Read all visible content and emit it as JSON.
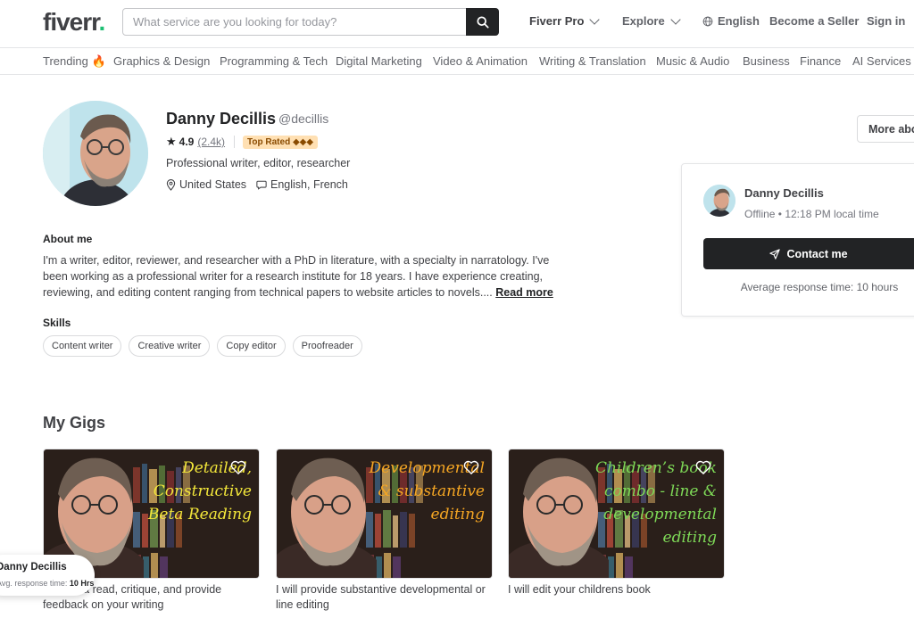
{
  "header": {
    "logo_text": "fiverr",
    "logo_dot": ".",
    "search_placeholder": "What service are you looking for today?",
    "nav": {
      "fiverr_pro": "Fiverr Pro",
      "explore": "Explore",
      "language": "English",
      "become_seller": "Become a Seller",
      "sign_in": "Sign in"
    }
  },
  "categories": [
    "Trending 🔥",
    "Graphics & Design",
    "Programming & Tech",
    "Digital Marketing",
    "Video & Animation",
    "Writing & Translation",
    "Music & Audio",
    "Business",
    "Finance",
    "AI Services"
  ],
  "profile": {
    "name": "Danny Decillis",
    "handle": "@decillis",
    "rating": "4.9",
    "review_count": "(2.4k)",
    "badge": "Top Rated ◆◆◆",
    "tagline": "Professional writer, editor, researcher",
    "location": "United States",
    "languages": "English, French",
    "more_about": "More about me"
  },
  "about": {
    "title": "About me",
    "text": "I'm a writer, editor, reviewer, and researcher with a PhD in literature, with a specialty in narratology. I've been working as a professional writer for a research institute for 18 years. I have experience creating, reviewing, and editing content ranging from technical papers to website articles to novels....",
    "read_more": "Read more"
  },
  "skills": {
    "title": "Skills",
    "items": [
      "Content writer",
      "Creative writer",
      "Copy editor",
      "Proofreader"
    ]
  },
  "contact_card": {
    "name": "Danny Decillis",
    "status": "Offline • 12:18 PM local time",
    "button": "Contact me",
    "response": "Average response time: 10 hours"
  },
  "gigs": {
    "title": "My Gigs",
    "items": [
      {
        "overlay": [
          "Detailed,",
          "Constructive",
          "Beta Reading"
        ],
        "overlay_color": "#f2e63a",
        "title": "I will beta read, critique, and provide feedback on your writing"
      },
      {
        "overlay": [
          "Developmental",
          "& substantive",
          "editing"
        ],
        "overlay_color": "#f5a623",
        "title": "I will provide substantive developmental or line editing"
      },
      {
        "overlay": [
          "Children’s book",
          "combo - line &",
          "developmental",
          "editing"
        ],
        "overlay_color": "#7ed957",
        "title": "I will edit your childrens book"
      }
    ]
  },
  "chat": {
    "name": "Danny Decillis",
    "response_label": "Avg. response time:",
    "response_value": "10 Hrs"
  }
}
